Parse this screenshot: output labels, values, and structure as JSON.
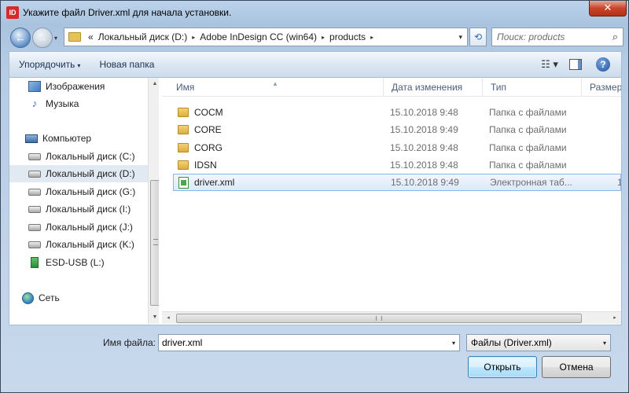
{
  "window": {
    "title": "Укажите файл Driver.xml для начала установки.",
    "app_icon_text": "ID",
    "close_glyph": "✕"
  },
  "nav": {
    "back_glyph": "←",
    "forward_glyph": "→",
    "dropdown_glyph": "▾"
  },
  "address": {
    "prefix": "«",
    "crumbs": [
      "Локальный диск (D:)",
      "Adobe InDesign CC (win64)",
      "products"
    ],
    "sep_glyph": "▸",
    "dropdown_glyph": "▾",
    "refresh_glyph": "⟲"
  },
  "search": {
    "placeholder": "Поиск: products",
    "icon_glyph": "⌕"
  },
  "toolbar": {
    "organize_label": "Упорядочить",
    "organize_arrow": "▾",
    "new_folder_label": "Новая папка",
    "view_glyph": "☷ ▾",
    "help_glyph": "?"
  },
  "sidebar": {
    "items": [
      {
        "label": "Изображения",
        "icon": "images-icon"
      },
      {
        "label": "Музыка",
        "icon": "music-icon"
      },
      {
        "label": "Компьютер",
        "icon": "computer-icon"
      },
      {
        "label": "Локальный диск (C:)",
        "icon": "drive-icon"
      },
      {
        "label": "Локальный диск (D:)",
        "icon": "drive-icon",
        "selected": true
      },
      {
        "label": "Локальный диск (G:)",
        "icon": "drive-icon"
      },
      {
        "label": "Локальный диск (I:)",
        "icon": "drive-icon"
      },
      {
        "label": "Локальный диск (J:)",
        "icon": "drive-icon"
      },
      {
        "label": "Локальный диск (K:)",
        "icon": "drive-icon"
      },
      {
        "label": "ESD-USB (L:)",
        "icon": "usb-drive-icon"
      },
      {
        "label": "Сеть",
        "icon": "network-icon"
      }
    ],
    "music_glyph": "♪",
    "scroll_up_glyph": "▲",
    "scroll_down_glyph": "▼"
  },
  "files": {
    "columns": [
      "Имя",
      "Дата изменения",
      "Тип",
      "Размер"
    ],
    "sort_glyph": "▲",
    "rows": [
      {
        "name": "COCM",
        "date": "15.10.2018 9:48",
        "type": "Папка с файлами",
        "size": "",
        "icon": "folder-icon"
      },
      {
        "name": "CORE",
        "date": "15.10.2018 9:49",
        "type": "Папка с файлами",
        "size": "",
        "icon": "folder-icon"
      },
      {
        "name": "CORG",
        "date": "15.10.2018 9:48",
        "type": "Папка с файлами",
        "size": "",
        "icon": "folder-icon"
      },
      {
        "name": "IDSN",
        "date": "15.10.2018 9:48",
        "type": "Папка с файлами",
        "size": "",
        "icon": "folder-icon"
      },
      {
        "name": "driver.xml",
        "date": "15.10.2018 9:49",
        "type": "Электронная таб...",
        "size": "1",
        "icon": "xml-file-icon",
        "selected": true
      }
    ],
    "hscroll_left_glyph": "◂",
    "hscroll_right_glyph": "▸"
  },
  "footer": {
    "filename_label": "Имя файла:",
    "filename_value": "driver.xml",
    "filename_drop_glyph": "▾",
    "filter_value": "Файлы (Driver.xml)",
    "filter_drop_glyph": "▾",
    "open_label": "Открыть",
    "cancel_label": "Отмена"
  }
}
